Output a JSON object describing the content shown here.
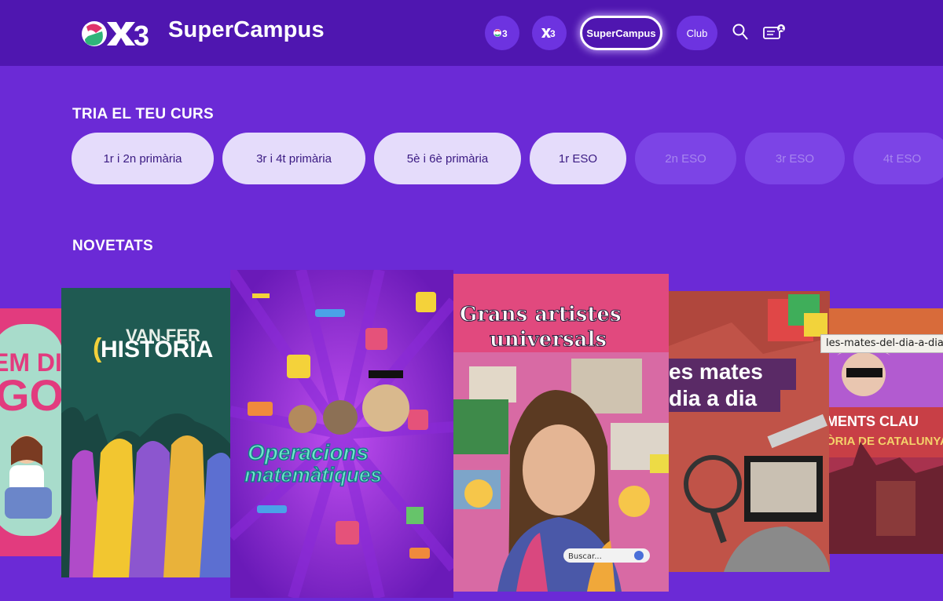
{
  "header": {
    "brand": "SuperCampus",
    "nav": [
      {
        "label": "",
        "icon": "sx3-logo-icon"
      },
      {
        "label": "",
        "icon": "x3-logo-icon"
      },
      {
        "label": "SuperCampus"
      },
      {
        "label": "Club"
      }
    ],
    "icons": [
      "search-icon",
      "profile-ticket-icon"
    ]
  },
  "courses": {
    "title": "TRIA EL TEU CURS",
    "items": [
      "1r i 2n primària",
      "3r i 4t primària",
      "5è i 6è primària",
      "1r ESO",
      "2n ESO",
      "3r ESO",
      "4t ESO"
    ]
  },
  "novetats": {
    "title": "NOVETATS",
    "cards": [
      {
        "title_lines": [
          "EM DIC",
          "GO"
        ]
      },
      {
        "title_top": "VAN FER",
        "title_main": "HISTÒRIA"
      },
      {
        "title_lines": [
          "Operacions",
          "matemàtiques"
        ]
      },
      {
        "title_lines": [
          "Grans artistes",
          "universals"
        ],
        "search_placeholder": "Buscar..."
      },
      {
        "title_lines": [
          "es mates",
          "dia a dia"
        ]
      },
      {
        "title_lines": [
          "MENTS CLAU",
          "ÒRIA DE CATALUNYA"
        ]
      }
    ],
    "tooltip": "les-mates-del-dia-a-dia"
  },
  "colors": {
    "background": "#6b2ad6",
    "header": "#4f16b0",
    "pill_active": "#e5dcfb",
    "pill_disabled": "#7c44e6"
  }
}
